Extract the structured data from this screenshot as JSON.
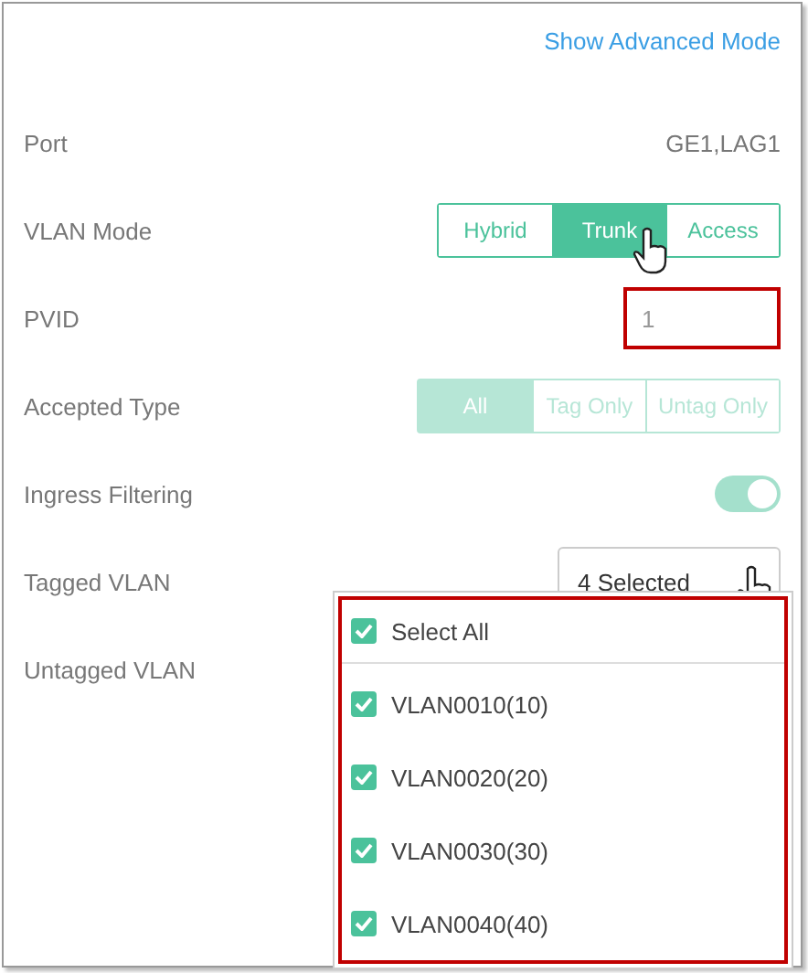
{
  "header_link": "Show Advanced Mode",
  "port": {
    "label": "Port",
    "value": "GE1,LAG1"
  },
  "vlan_mode": {
    "label": "VLAN Mode",
    "options": [
      {
        "label": "Hybrid",
        "selected": false
      },
      {
        "label": "Trunk",
        "selected": true
      },
      {
        "label": "Access",
        "selected": false
      }
    ]
  },
  "pvid": {
    "label": "PVID",
    "value": "1",
    "highlighted": true
  },
  "accepted_type": {
    "label": "Accepted Type",
    "disabled": true,
    "options": [
      {
        "label": "All",
        "selected": true
      },
      {
        "label": "Tag Only",
        "selected": false
      },
      {
        "label": "Untag Only",
        "selected": false
      }
    ]
  },
  "ingress_filtering": {
    "label": "Ingress Filtering",
    "on": true,
    "disabled": true
  },
  "tagged_vlan": {
    "label": "Tagged VLAN",
    "value": "4 Selected"
  },
  "untagged_vlan": {
    "label": "Untagged VLAN"
  },
  "dropdown": {
    "highlighted": true,
    "select_all": {
      "label": "Select All",
      "checked": true
    },
    "items": [
      {
        "label": "VLAN0010(10)",
        "checked": true
      },
      {
        "label": "VLAN0020(20)",
        "checked": true
      },
      {
        "label": "VLAN0030(30)",
        "checked": true
      },
      {
        "label": "VLAN0040(40)",
        "checked": true
      }
    ]
  }
}
